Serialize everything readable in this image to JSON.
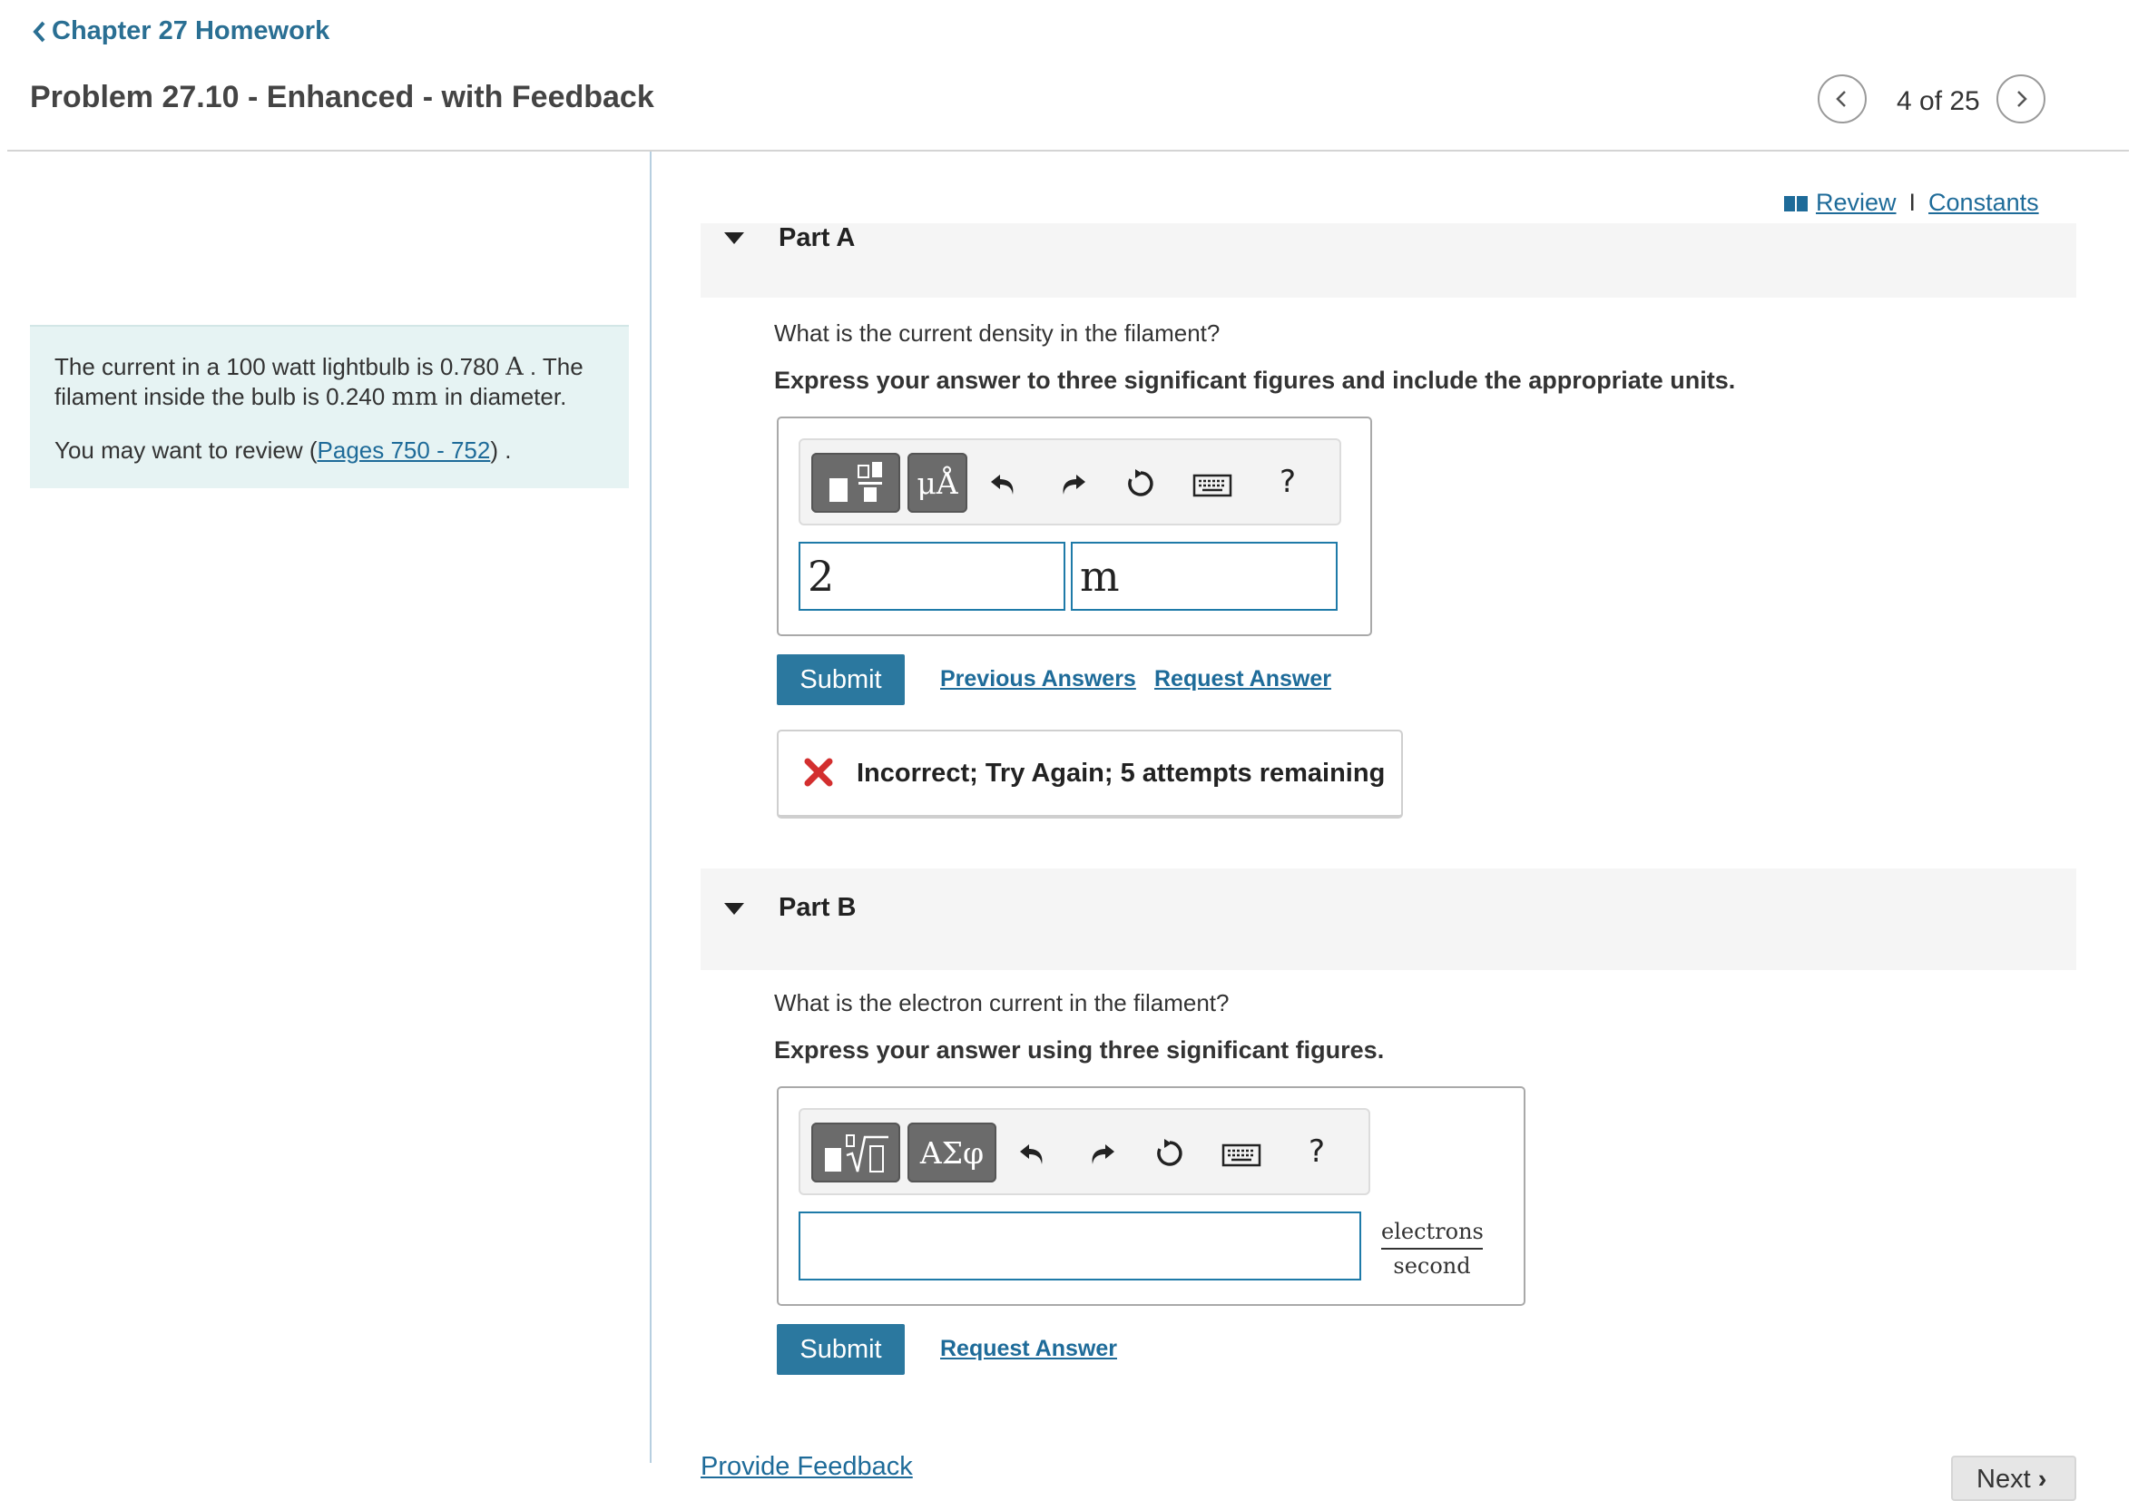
{
  "header": {
    "back_link": "Chapter 27 Homework",
    "problem_title": "Problem 27.10 - Enhanced - with Feedback",
    "nav_count": "4 of 25"
  },
  "intro": {
    "line1_a": "The current in a 100 watt lightbulb is 0.780 ",
    "line1_unit": "A",
    "line1_b": " . The filament inside the bulb is 0.240 ",
    "line1_unit2": "mm",
    "line1_c": " in diameter.",
    "review_prefix": "You may want to review (",
    "review_link": "Pages 750 - 752",
    "review_suffix": ") ."
  },
  "links": {
    "review": "Review",
    "separator": "I",
    "constants": "Constants"
  },
  "part_a": {
    "title": "Part A",
    "question": "What is the current density in the filament?",
    "instruction": "Express your answer to three significant figures and include the appropriate units.",
    "symbol_button": "μÅ",
    "help": "?",
    "value": "2",
    "units": "m",
    "submit": "Submit",
    "previous_answers": "Previous Answers",
    "request_answer": "Request Answer",
    "feedback": "Incorrect; Try Again; 5 attempts remaining"
  },
  "part_b": {
    "title": "Part B",
    "question": "What is the electron current in the filament?",
    "instruction": "Express your answer using three significant figures.",
    "symbol_button": "ΑΣφ",
    "help": "?",
    "value": "",
    "units_numerator": "electrons",
    "units_denominator": "second",
    "submit": "Submit",
    "request_answer": "Request Answer"
  },
  "footer": {
    "provide_feedback": "Provide Feedback",
    "next": "Next"
  },
  "colors": {
    "accent": "#2b789f",
    "link": "#1e6b99",
    "intro_bg": "#e6f3f3",
    "error": "#d32f2f"
  }
}
